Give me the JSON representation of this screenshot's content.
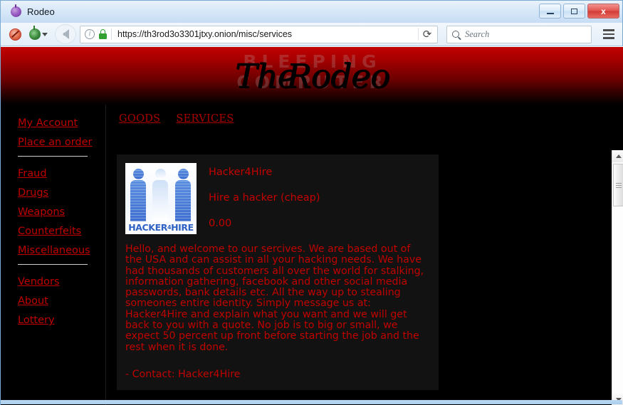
{
  "window": {
    "title": "Rodeo",
    "icon": "onion-icon",
    "controls": {
      "minimize": "minimize",
      "maximize": "maximize",
      "close": "x"
    }
  },
  "toolbar": {
    "noscript_icon": "noscript-icon",
    "tor_icon": "onion-icon",
    "back_label": "back",
    "url": "https://th3rod3o3301jtxy.onion/misc/services",
    "identity_icon": "info-icon",
    "lock_icon": "padlock-icon",
    "reload_glyph": "⟳",
    "search_placeholder": "Search",
    "search_icon": "search-icon",
    "menu_icon": "hamburger-icon"
  },
  "banner": {
    "title_word1": "The",
    "title_word2": "Rodeo",
    "watermark_line1": "BLEEPING",
    "watermark_line2": "COMPUTER"
  },
  "sidebar": {
    "group1": [
      {
        "label": "My Account"
      },
      {
        "label": "Place an order"
      }
    ],
    "group2": [
      {
        "label": "Fraud"
      },
      {
        "label": "Drugs"
      },
      {
        "label": "Weapons"
      },
      {
        "label": "Counterfeits"
      },
      {
        "label": "Miscellaneous"
      }
    ],
    "group3": [
      {
        "label": "Vendors"
      },
      {
        "label": "About"
      },
      {
        "label": "Lottery"
      }
    ]
  },
  "topnav": [
    {
      "label": "GOODS"
    },
    {
      "label": "SERVICES"
    }
  ],
  "listing": {
    "thumb_label_prefix": "HACKER",
    "thumb_label_four": "4",
    "thumb_label_suffix": "HIRE",
    "title": "Hacker4Hire",
    "subtitle": "Hire a hacker (cheap)",
    "price": "0.00",
    "description": "Hello, and welcome to our sercives. We are based out of the USA and can assist in all your hacking needs. We have had thousands of customers all over the world for stalking, information gathering, facebook and other social media passwords, bank details etc. All the way up to stealing someones entire identity. Simply message us at: Hacker4Hire and explain what you want and we will get back to you with a quote. No job is to big or small, we expect 50 percent up front before starting the job and the rest when it is done.",
    "contact": "- Contact: Hacker4Hire"
  },
  "colors": {
    "accent_red": "#c40000",
    "banner_red": "#c20000",
    "page_background": "#000000",
    "card_background": "#121212"
  }
}
